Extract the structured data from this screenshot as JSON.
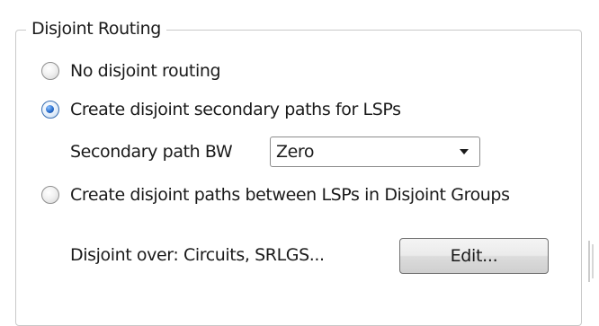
{
  "group": {
    "title": "Disjoint Routing"
  },
  "options": [
    {
      "label": "No disjoint routing",
      "selected": false
    },
    {
      "label": "Create disjoint secondary paths for LSPs",
      "selected": true
    },
    {
      "label": "Create disjoint paths between LSPs in Disjoint Groups",
      "selected": false
    }
  ],
  "secondary_bw": {
    "label": "Secondary path BW",
    "value": "Zero"
  },
  "disjoint_over": {
    "label": "Disjoint over: Circuits, SRLGS...",
    "button_label": "Edit..."
  },
  "colors": {
    "radio_selected": "#2a6fcf",
    "group_border": "#c9c9c9"
  }
}
